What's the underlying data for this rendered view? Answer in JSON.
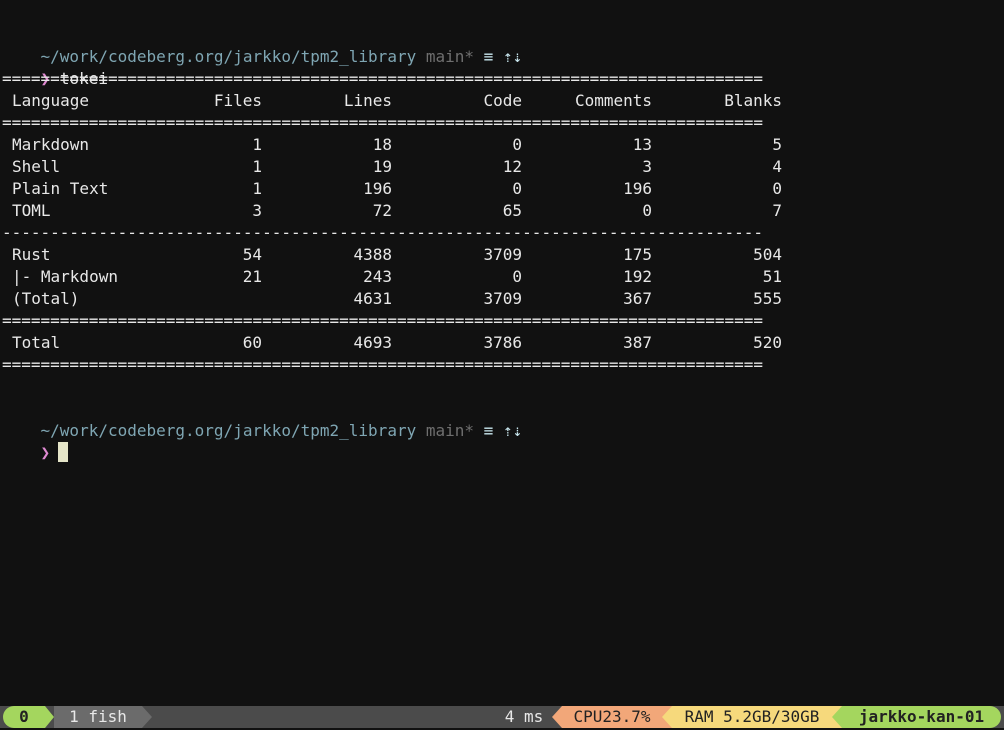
{
  "prompt1": {
    "path": "~/work/codeberg.org/jarkko/tpm2_library",
    "branch": "main*",
    "status": "≡ ⇡⇣",
    "symbol": "❯",
    "command": "tokei"
  },
  "tokei": {
    "rule_heavy": "===============================================================================",
    "rule_light": "-------------------------------------------------------------------------------",
    "headers": [
      "Language",
      "Files",
      "Lines",
      "Code",
      "Comments",
      "Blanks"
    ],
    "rows_top": [
      [
        "Markdown",
        "1",
        "18",
        "0",
        "13",
        "5"
      ],
      [
        "Shell",
        "1",
        "19",
        "12",
        "3",
        "4"
      ],
      [
        "Plain Text",
        "1",
        "196",
        "0",
        "196",
        "0"
      ],
      [
        "TOML",
        "3",
        "72",
        "65",
        "0",
        "7"
      ]
    ],
    "rows_mid": [
      [
        "Rust",
        "54",
        "4388",
        "3709",
        "175",
        "504"
      ],
      [
        "|- Markdown",
        "21",
        "243",
        "0",
        "192",
        "51"
      ],
      [
        "(Total)",
        "",
        "4631",
        "3709",
        "367",
        "555"
      ]
    ],
    "total": [
      "Total",
      "60",
      "4693",
      "3786",
      "387",
      "520"
    ]
  },
  "prompt2": {
    "path": "~/work/codeberg.org/jarkko/tpm2_library",
    "branch": "main*",
    "status": "≡ ⇡⇣",
    "symbol": "❯"
  },
  "statusbar": {
    "session": "0",
    "window": "1 fish",
    "duration": "4 ms",
    "cpu": "CPU23.7%",
    "ram": "RAM 5.2GB/30GB",
    "host": "jarkko-kan-01"
  }
}
